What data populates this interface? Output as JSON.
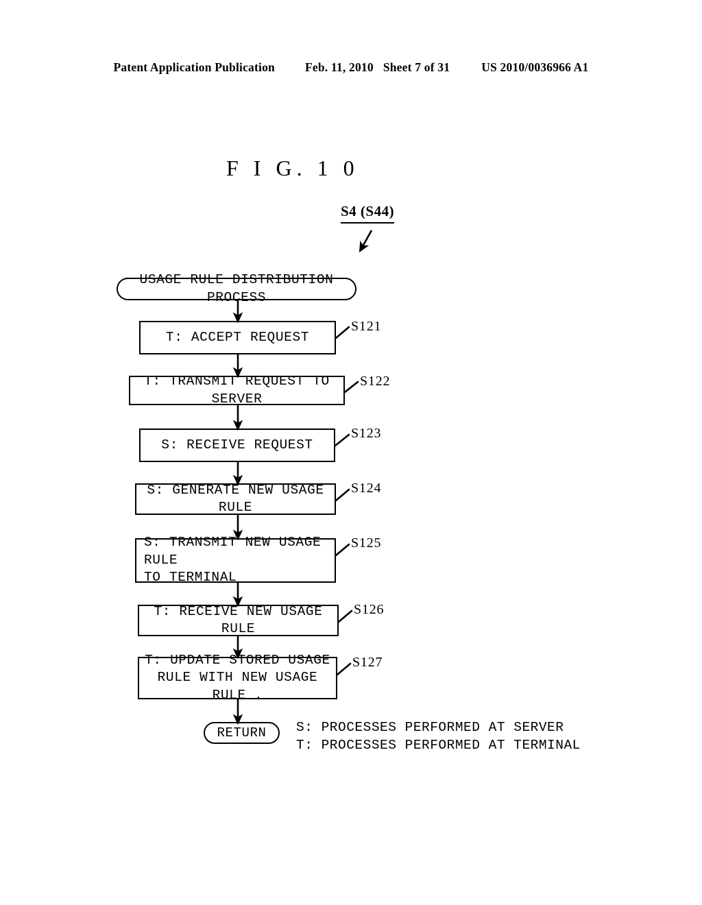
{
  "header": {
    "publication": "Patent Application Publication",
    "date": "Feb. 11, 2010",
    "sheet": "Sheet 7 of 31",
    "patent_number": "US 2010/0036966 A1"
  },
  "figure": {
    "title": "F I G.  1 0",
    "entry_callout": "S4 (S44)"
  },
  "flow": {
    "start_node": {
      "label": "USAGE RULE DISTRIBUTION PROCESS",
      "shape": "terminator"
    },
    "end_node": {
      "label": "RETURN",
      "shape": "terminator"
    },
    "steps": [
      {
        "id": "S121",
        "label": "T: ACCEPT REQUEST"
      },
      {
        "id": "S122",
        "label": "T: TRANSMIT REQUEST TO SERVER"
      },
      {
        "id": "S123",
        "label": "S: RECEIVE REQUEST"
      },
      {
        "id": "S124",
        "label": "S: GENERATE NEW USAGE RULE"
      },
      {
        "id": "S125",
        "label": "S: TRANSMIT NEW USAGE RULE\nTO TERMINAL"
      },
      {
        "id": "S126",
        "label": "T: RECEIVE NEW USAGE RULE"
      },
      {
        "id": "S127",
        "label": "T: UPDATE STORED USAGE\nRULE WITH NEW USAGE RULE ."
      }
    ]
  },
  "legend": {
    "text": "S: PROCESSES PERFORMED AT SERVER\nT: PROCESSES PERFORMED AT TERMINAL"
  },
  "colors": {
    "ink": "#000000",
    "page": "#ffffff"
  }
}
